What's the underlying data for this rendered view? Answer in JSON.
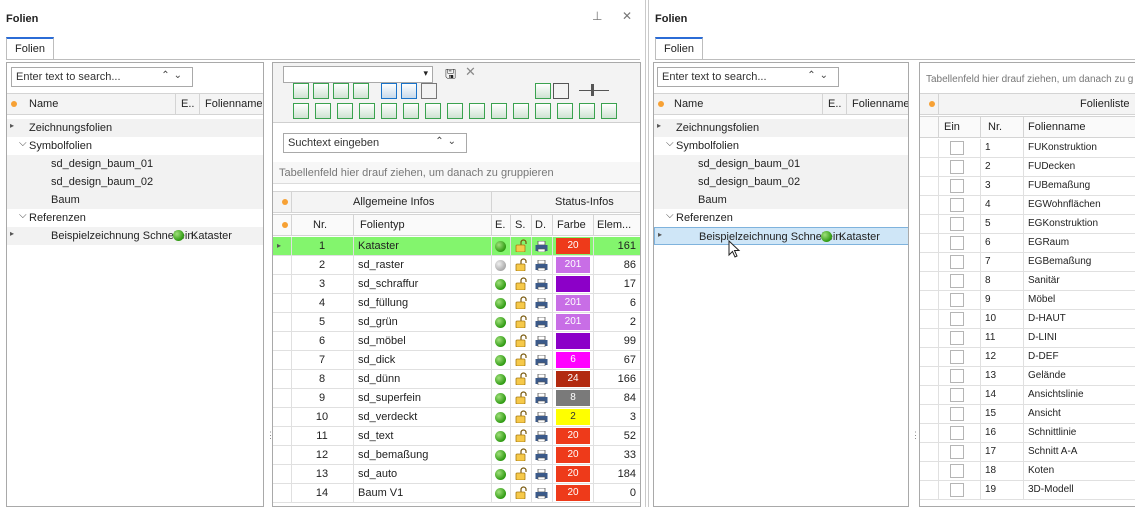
{
  "left_window": {
    "title": "Folien",
    "pin_icon": "pin-icon",
    "close_icon": "close-icon",
    "tab_label": "Folien"
  },
  "left_tree": {
    "search_placeholder": "Enter text to search...",
    "columns": [
      "Name",
      "E..",
      "Folienname"
    ],
    "rows": [
      {
        "label": "Zeichnungsfolien",
        "indent": 1,
        "expander": "",
        "selected": false
      },
      {
        "label": "Symbolfolien",
        "indent": 0,
        "expander": "⌵",
        "selected": false
      },
      {
        "label": "sd_design_baum_01",
        "indent": 2,
        "expander": "",
        "selected": false
      },
      {
        "label": "sd_design_baum_02",
        "indent": 2,
        "expander": "",
        "selected": false
      },
      {
        "label": "Baum",
        "indent": 2,
        "expander": "",
        "selected": false
      },
      {
        "label": "Referenzen",
        "indent": 0,
        "expander": "⌵",
        "selected": false
      },
      {
        "label": "Beispielzeichnung Schnellein:",
        "indent": 2,
        "expander": "",
        "folienname": "Kataster",
        "selected": false
      }
    ]
  },
  "mid_grid": {
    "search_placeholder": "Suchtext eingeben",
    "group_hint": "Tabellenfeld hier drauf ziehen, um danach zu gruppieren",
    "band_allgemein": "Allgemeine Infos",
    "band_status": "Status-Infos",
    "columns": {
      "nr": "Nr.",
      "typ": "Folientyp",
      "e": "E.",
      "s": "S.",
      "d": "D.",
      "farbe": "Farbe",
      "elem": "Elem..."
    },
    "rows": [
      {
        "nr": "1",
        "typ": "Kataster",
        "ein": true,
        "farbe": "20",
        "color": "#ee3a1a",
        "elem": "161",
        "selected": true
      },
      {
        "nr": "2",
        "typ": "sd_raster",
        "ein": false,
        "farbe": "201",
        "color": "#c86ee6",
        "elem": "86",
        "selected": false
      },
      {
        "nr": "3",
        "typ": "sd_schraffur",
        "ein": true,
        "farbe": "",
        "color": "#8c00c8",
        "elem": "17",
        "selected": false
      },
      {
        "nr": "4",
        "typ": "sd_füllung",
        "ein": true,
        "farbe": "201",
        "color": "#c86ee6",
        "elem": "6",
        "selected": false
      },
      {
        "nr": "5",
        "typ": "sd_grün",
        "ein": true,
        "farbe": "201",
        "color": "#c86ee6",
        "elem": "2",
        "selected": false
      },
      {
        "nr": "6",
        "typ": "sd_möbel",
        "ein": true,
        "farbe": "",
        "color": "#8c00c8",
        "elem": "99",
        "selected": false
      },
      {
        "nr": "7",
        "typ": "sd_dick",
        "ein": true,
        "farbe": "6",
        "color": "#ff00ff",
        "elem": "67",
        "selected": false
      },
      {
        "nr": "8",
        "typ": "sd_dünn",
        "ein": true,
        "farbe": "24",
        "color": "#b22a10",
        "elem": "166",
        "selected": false
      },
      {
        "nr": "9",
        "typ": "sd_superfein",
        "ein": true,
        "farbe": "8",
        "color": "#7a7a7a",
        "elem": "84",
        "selected": false
      },
      {
        "nr": "10",
        "typ": "sd_verdeckt",
        "ein": true,
        "farbe": "2",
        "color": "#ffff00",
        "elem": "3",
        "selected": false
      },
      {
        "nr": "11",
        "typ": "sd_text",
        "ein": true,
        "farbe": "20",
        "color": "#ee3a1a",
        "elem": "52",
        "selected": false
      },
      {
        "nr": "12",
        "typ": "sd_bemaßung",
        "ein": true,
        "farbe": "20",
        "color": "#ee3a1a",
        "elem": "33",
        "selected": false
      },
      {
        "nr": "13",
        "typ": "sd_auto",
        "ein": true,
        "farbe": "20",
        "color": "#ee3a1a",
        "elem": "184",
        "selected": false
      },
      {
        "nr": "14",
        "typ": "Baum V1",
        "ein": true,
        "farbe": "20",
        "color": "#ee3a1a",
        "elem": "0",
        "selected": false
      }
    ]
  },
  "right_window": {
    "title": "Folien",
    "tab_label": "Folien"
  },
  "right_tree": {
    "search_placeholder": "Enter text to search...",
    "columns": [
      "Name",
      "E..",
      "Folienname"
    ],
    "rows": [
      {
        "label": "Zeichnungsfolien",
        "indent": 1,
        "expander": "",
        "selected": false
      },
      {
        "label": "Symbolfolien",
        "indent": 0,
        "expander": "⌵",
        "selected": false
      },
      {
        "label": "sd_design_baum_01",
        "indent": 2,
        "expander": "",
        "selected": false
      },
      {
        "label": "sd_design_baum_02",
        "indent": 2,
        "expander": "",
        "selected": false
      },
      {
        "label": "Baum",
        "indent": 2,
        "expander": "",
        "selected": false
      },
      {
        "label": "Referenzen",
        "indent": 0,
        "expander": "⌵",
        "selected": false
      },
      {
        "label": "Beispielzeichnung Schnellein:",
        "indent": 2,
        "expander": "",
        "folienname": "Kataster",
        "selected": true
      }
    ]
  },
  "right_list": {
    "group_hint": "Tabellenfeld hier drauf ziehen, um danach zu g",
    "band": "Folienliste",
    "columns": {
      "ein": "Ein",
      "nr": "Nr.",
      "name": "Folienname"
    },
    "rows": [
      {
        "nr": "1",
        "name": "FUKonstruktion"
      },
      {
        "nr": "2",
        "name": "FUDecken"
      },
      {
        "nr": "3",
        "name": "FUBemaßung"
      },
      {
        "nr": "4",
        "name": "EGWohnflächen"
      },
      {
        "nr": "5",
        "name": "EGKonstruktion"
      },
      {
        "nr": "6",
        "name": "EGRaum"
      },
      {
        "nr": "7",
        "name": "EGBemaßung"
      },
      {
        "nr": "8",
        "name": "Sanitär"
      },
      {
        "nr": "9",
        "name": "Möbel"
      },
      {
        "nr": "10",
        "name": "D-HAUT"
      },
      {
        "nr": "11",
        "name": "D-LINI"
      },
      {
        "nr": "12",
        "name": "D-DEF"
      },
      {
        "nr": "13",
        "name": "Gelände"
      },
      {
        "nr": "14",
        "name": "Ansichtslinie"
      },
      {
        "nr": "15",
        "name": "Ansicht"
      },
      {
        "nr": "16",
        "name": "Schnittlinie"
      },
      {
        "nr": "17",
        "name": "Schnitt A-A"
      },
      {
        "nr": "18",
        "name": "Koten"
      },
      {
        "nr": "19",
        "name": "3D-Modell"
      }
    ]
  }
}
